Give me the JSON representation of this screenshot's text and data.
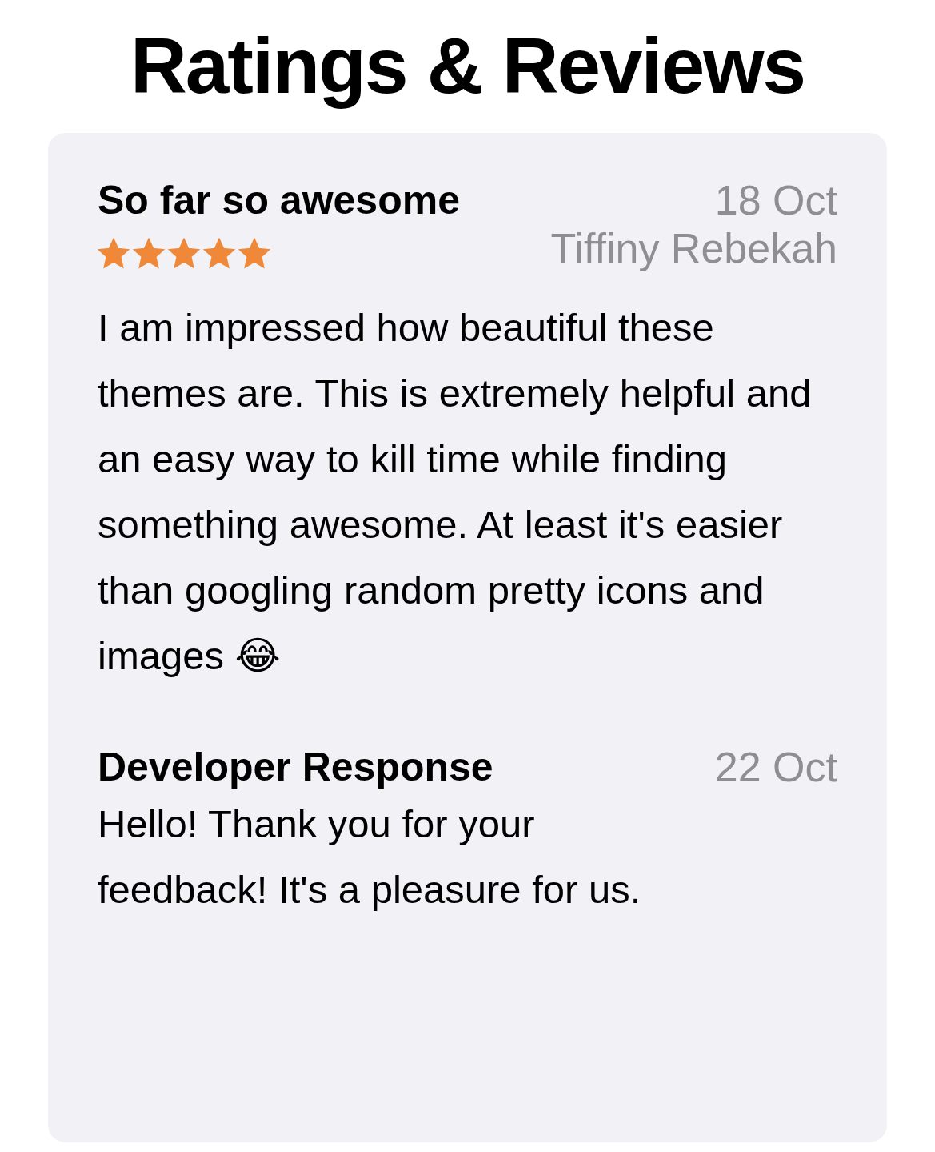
{
  "title": "Ratings & Reviews",
  "review": {
    "title": "So far so awesome",
    "date": "18 Oct",
    "stars": 5,
    "author": "Tiffiny Rebekah",
    "body": "I am impressed how beautiful these themes are. This is extremely helpful and an easy way to kill time while finding something awesome. At least it's easier than googling random pretty icons and images 😂"
  },
  "developer_response": {
    "title": "Developer Response",
    "date": "22 Oct",
    "body": "Hello! Thank you for your feedback! It's a pleasure for us."
  }
}
